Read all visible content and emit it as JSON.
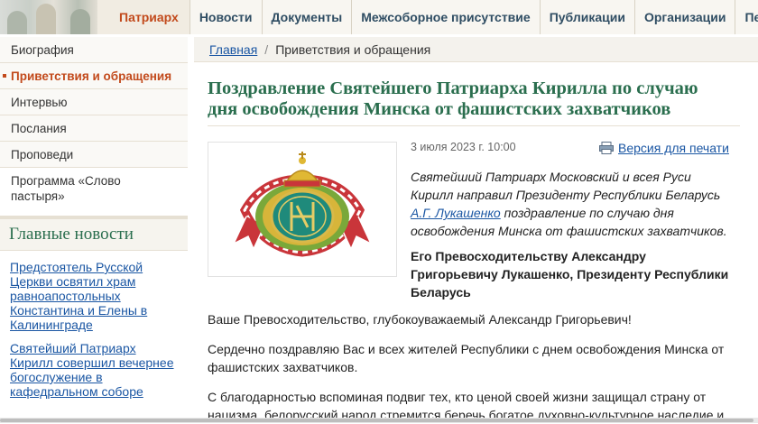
{
  "nav": {
    "items": [
      "Патриарх",
      "Новости",
      "Документы",
      "Межсоборное присутствие",
      "Публикации",
      "Организации",
      "Пер"
    ]
  },
  "sidebar": {
    "items": [
      {
        "label": "Биография"
      },
      {
        "label": "Приветствия и обращения"
      },
      {
        "label": "Интервью"
      },
      {
        "label": "Послания"
      },
      {
        "label": "Проповеди"
      },
      {
        "label": "Программа «Слово пастыря»"
      }
    ],
    "news_heading": "Главные новости",
    "news": [
      {
        "text": "Предстоятель Русской Церкви освятил храм равноапостольных Константина и Елены в Калининграде"
      },
      {
        "text": "Святейший Патриарх Кирилл совершил вечернее богослужение в кафедральном соборе"
      }
    ]
  },
  "breadcrumb": {
    "home": "Главная",
    "separator": "/",
    "current": "Приветствия и обращения"
  },
  "article": {
    "title": "Поздравление Святейшего Патриарха Кирилла по случаю дня освобождения Минска от фашистских захватчиков",
    "date": "3 июля 2023 г. 10:00",
    "print_label": "Версия для печати",
    "lead_before": "Святейший Патриарх Московский и всея Руси Кирилл направил Президенту Республики Беларусь ",
    "lead_link": "А.Г. Лукашенко",
    "lead_after": " поздравление по случаю дня освобождения Минска от фашистских захватчиков.",
    "addressee": "Его Превосходительству Александру Григорьевичу Лукашенко, Президенту Республики Беларусь",
    "paragraphs": [
      "Ваше Превосходительство, глубокоуважаемый Александр Григорьевич!",
      "Сердечно поздравляю Вас и всех жителей Республики с днем освобождения Минска от фашистских захватчиков.",
      "С благодарностью вспоминая подвиг тех, кто ценой своей жизни защищал страну от нацизма, белорусский народ стремится беречь богатое духовно-культурное наследие и"
    ]
  },
  "colors": {
    "accent": "#c24a1c",
    "title_green": "#2a6e4e",
    "link": "#1a56a3"
  }
}
